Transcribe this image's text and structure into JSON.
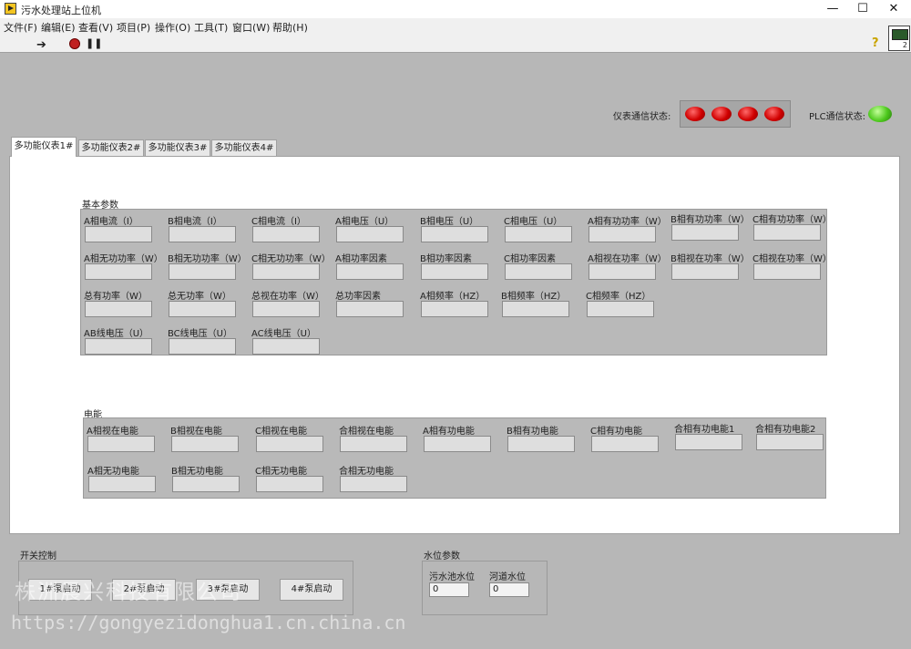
{
  "window": {
    "title": "污水处理站上位机",
    "min": "—",
    "max": "☐",
    "close": "✕"
  },
  "menu": [
    "文件(F)",
    "编辑(E)",
    "查看(V)",
    "项目(P)",
    "操作(O)",
    "工具(T)",
    "窗口(W)",
    "帮助(H)"
  ],
  "toolbar": {
    "run_icon": "run-arrow-icon",
    "stop_icon": "stop-icon",
    "pause_icon": "pause-icon",
    "help_icon": "help-icon",
    "vi_number": "2"
  },
  "status": {
    "meter_label": "仪表通信状态:",
    "meter_leds": [
      "red",
      "red",
      "red",
      "red"
    ],
    "plc_label": "PLC通信状态:",
    "plc_led": "green"
  },
  "tabs": [
    "多功能仪表1#",
    "多功能仪表2#",
    "多功能仪表3#",
    "多功能仪表4#"
  ],
  "basic": {
    "title": "基本参数",
    "row1": [
      "A相电流（I）",
      "B相电流（I）",
      "C相电流（I）",
      "A相电压（U）",
      "B相电压（U）",
      "C相电压（U）",
      "A相有功功率（W）",
      "B相有功功率（W）",
      "C相有功功率（W）"
    ],
    "row2": [
      "A相无功功率（W）",
      "B相无功功率（W）",
      "C相无功功率（W）",
      "A相功率因素",
      "B相功率因素",
      "C相功率因素",
      "A相视在功率（W）",
      "B相视在功率（W）",
      "C相视在功率（W）"
    ],
    "row3": [
      "总有功率（W）",
      "总无功率（W）",
      "总视在功率（W）",
      "总功率因素",
      "A相频率（HZ）",
      "B相频率（HZ）",
      "C相频率（HZ）"
    ],
    "row4": [
      "AB线电压（U）",
      "BC线电压（U）",
      "AC线电压（U）"
    ]
  },
  "energy": {
    "title": "电能",
    "row1": [
      "A相视在电能",
      "B相视在电能",
      "C相视在电能",
      "合相视在电能",
      "A相有功电能",
      "B相有功电能",
      "C相有功电能",
      "合相有功电能1",
      "合相有功电能2"
    ],
    "row2": [
      "A相无功电能",
      "B相无功电能",
      "C相无功电能",
      "合相无功电能"
    ]
  },
  "switch": {
    "title": "开关控制",
    "buttons": [
      "1#泵启动",
      "2#泵启动",
      "3#泵启动",
      "4#泵启动"
    ]
  },
  "level": {
    "title": "水位参数",
    "pool_label": "污水池水位",
    "pool_value": "0",
    "river_label": "河道水位",
    "river_value": "0"
  },
  "watermark": {
    "line1": "株洲晨兴科技有限公司",
    "line2": "https://gongyezidonghua1.cn.china.cn"
  }
}
